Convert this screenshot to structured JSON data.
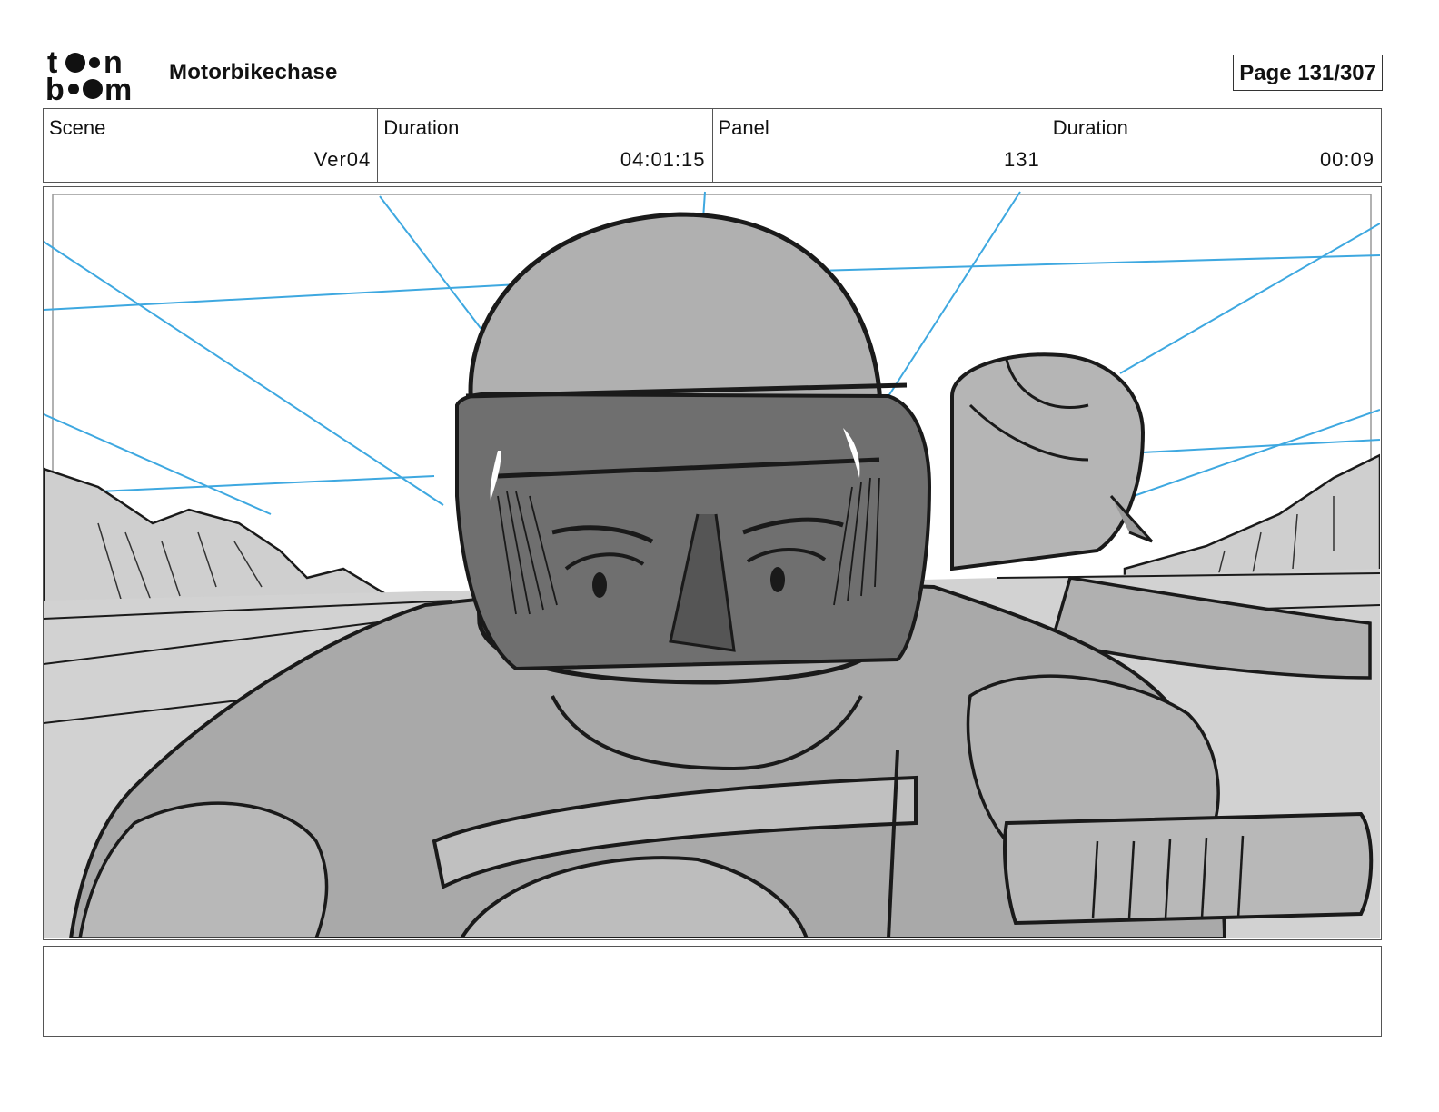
{
  "header": {
    "logo_text": "toon boom",
    "project_title": "Motorbikechase",
    "page_number": "Page 131/307"
  },
  "info": {
    "scene_label": "Scene",
    "scene_value": "Ver04",
    "scene_duration_label": "Duration",
    "scene_duration_value": "04:01:15",
    "panel_label": "Panel",
    "panel_value": "131",
    "panel_duration_label": "Duration",
    "panel_duration_value": "00:09"
  },
  "panel": {
    "image_subject": "storyboard-sketch-motorbike-rider"
  },
  "notes": {
    "text": ""
  },
  "colors": {
    "perspective_lines": "#3ea8e0",
    "sketch_gray_light": "#c9c9c9",
    "sketch_gray_mid": "#a9a9a9",
    "sketch_gray_dark": "#7a7a7a",
    "ink": "#1a1a1a"
  }
}
